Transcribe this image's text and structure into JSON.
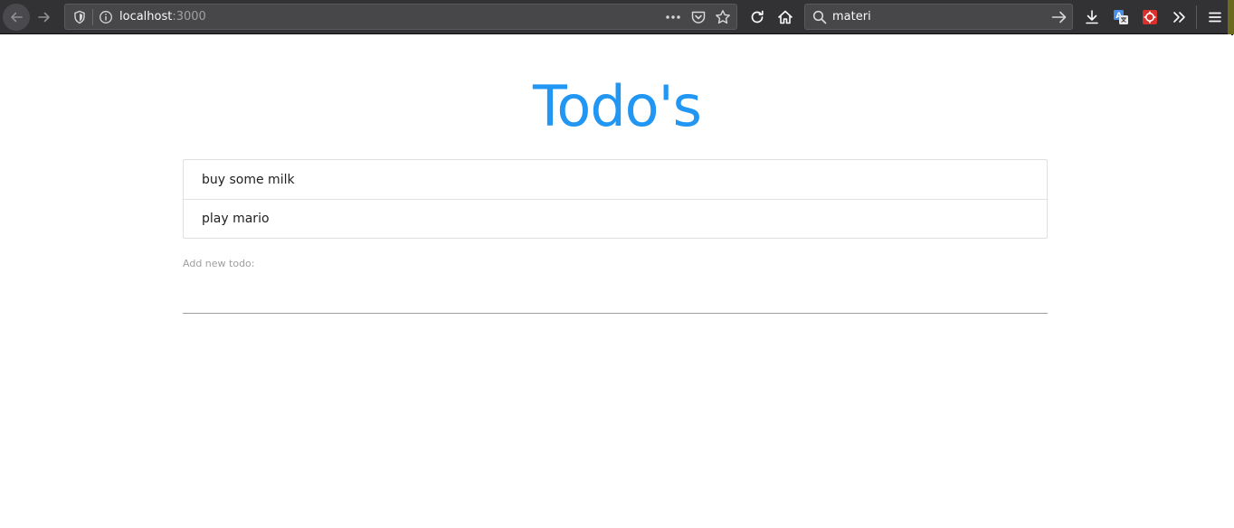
{
  "browser": {
    "url_host": "localhost",
    "url_port": ":3000",
    "search_value": "materi"
  },
  "page": {
    "title": "Todo's",
    "todos": [
      {
        "text": "buy some milk"
      },
      {
        "text": "play mario"
      }
    ],
    "add_label": "Add new todo:",
    "add_value": ""
  },
  "colors": {
    "accent": "#2196f3",
    "toolbar_bg": "#323234"
  }
}
